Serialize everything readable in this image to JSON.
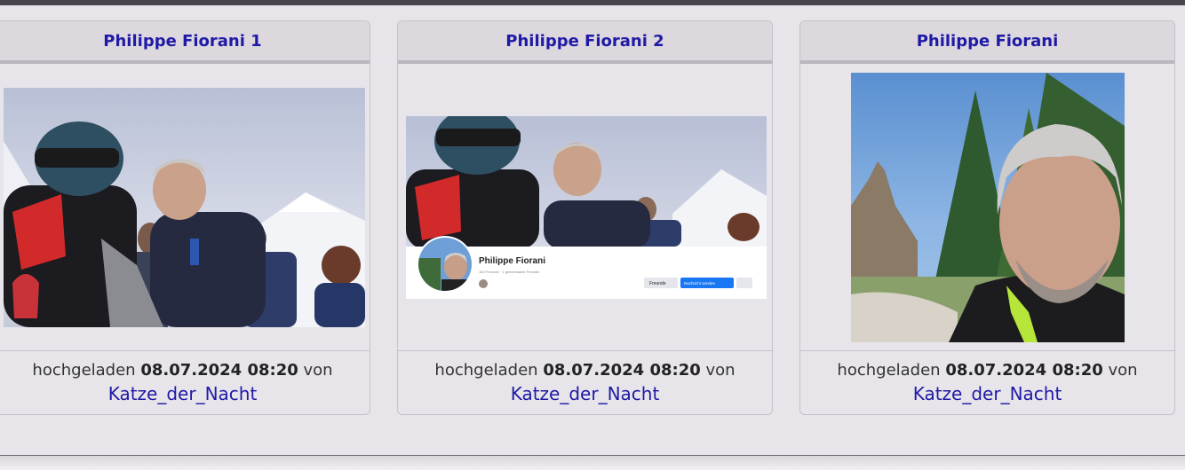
{
  "cards": [
    {
      "title": "Philippe Fiorani 1",
      "upload_prefix": "hochgeladen",
      "upload_datetime": "08.07.2024 08:20",
      "upload_suffix": "von",
      "uploader": "Katze_der_Nacht"
    },
    {
      "title": "Philippe Fiorani 2",
      "upload_prefix": "hochgeladen",
      "upload_datetime": "08.07.2024 08:20",
      "upload_suffix": "von",
      "uploader": "Katze_der_Nacht",
      "profile_overlay": {
        "name": "Philippe Fiorani",
        "sub": "163 Freunde · 1 gemeinsame Freunde",
        "btn_friends": "Freunde",
        "btn_message": "Nachricht senden"
      }
    },
    {
      "title": "Philippe Fiorani",
      "upload_prefix": "hochgeladen",
      "upload_datetime": "08.07.2024 08:20",
      "upload_suffix": "von",
      "uploader": "Katze_der_Nacht"
    }
  ],
  "colors": {
    "link": "#1f1aa6",
    "card_header_bg": "#dcd8de",
    "page_bg": "#e8e5ea",
    "top_bar": "#4a454d"
  }
}
